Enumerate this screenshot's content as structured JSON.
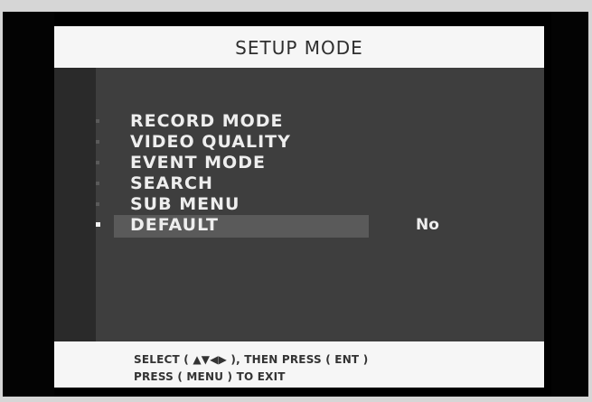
{
  "screen": {
    "title": "SETUP MODE",
    "menu_items": [
      {
        "label": "RECORD MODE",
        "value": ""
      },
      {
        "label": "VIDEO QUALITY",
        "value": ""
      },
      {
        "label": "EVENT MODE",
        "value": ""
      },
      {
        "label": "SEARCH",
        "value": ""
      },
      {
        "label": "SUB MENU",
        "value": ""
      },
      {
        "label": "DEFAULT",
        "value": "No"
      }
    ],
    "selected_index": 5,
    "footer": {
      "line1": "SELECT ( ▲▼◀▶ ), THEN PRESS ( ENT )",
      "line2": "PRESS ( MENU ) TO EXIT"
    }
  },
  "colors": {
    "title_bg": "#f6f6f6",
    "menu_bg": "#3e3e3e",
    "highlight": "#5a5a5a",
    "text": "#eeeeee"
  }
}
